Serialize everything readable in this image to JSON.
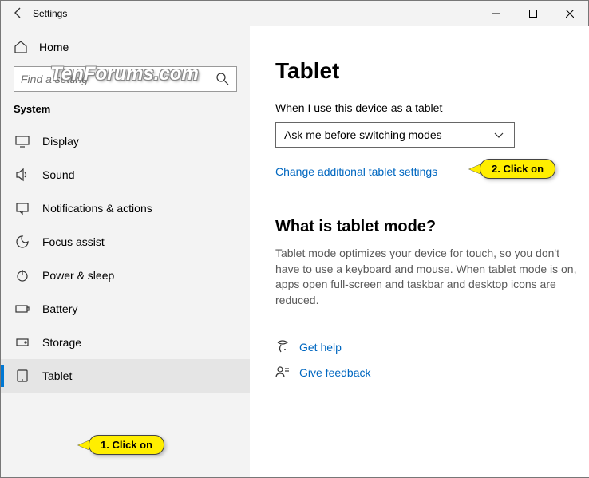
{
  "window": {
    "title": "Settings"
  },
  "watermark": "TenForums.com",
  "sidebar": {
    "home": "Home",
    "search_placeholder": "Find a setting",
    "category": "System",
    "items": [
      {
        "label": "Display",
        "active": false
      },
      {
        "label": "Sound",
        "active": false
      },
      {
        "label": "Notifications & actions",
        "active": false
      },
      {
        "label": "Focus assist",
        "active": false
      },
      {
        "label": "Power & sleep",
        "active": false
      },
      {
        "label": "Battery",
        "active": false
      },
      {
        "label": "Storage",
        "active": false
      },
      {
        "label": "Tablet",
        "active": true
      }
    ]
  },
  "content": {
    "title": "Tablet",
    "field_label": "When I use this device as a tablet",
    "dropdown_value": "Ask me before switching modes",
    "link": "Change additional tablet settings",
    "section_title": "What is tablet mode?",
    "description": "Tablet mode optimizes your device for touch, so you don't have to use a keyboard and mouse. When tablet mode is on, apps open full-screen and taskbar and desktop icons are reduced.",
    "help": "Get help",
    "feedback": "Give feedback"
  },
  "callouts": {
    "c1": "1. Click on",
    "c2": "2. Click on"
  }
}
